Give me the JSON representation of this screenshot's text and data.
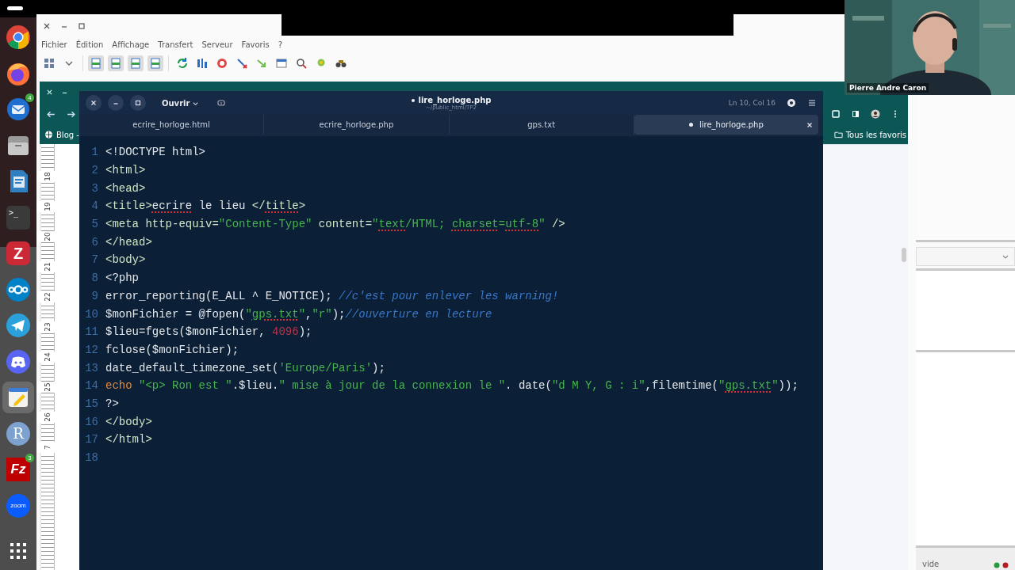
{
  "dock": {
    "items": [
      {
        "kind": "chrome",
        "selected": false
      },
      {
        "kind": "firefox",
        "selected": false
      },
      {
        "kind": "thunderbird",
        "selected": false,
        "badge": "4"
      },
      {
        "kind": "files",
        "selected": false
      },
      {
        "kind": "writer",
        "selected": false
      },
      {
        "kind": "terminal",
        "label": ">_",
        "selected": false
      },
      {
        "kind": "zotero",
        "label": "Z",
        "selected": false
      },
      {
        "kind": "nextcloud",
        "selected": false
      },
      {
        "kind": "telegram",
        "selected": false
      },
      {
        "kind": "discord",
        "selected": false
      },
      {
        "kind": "text-editor",
        "selected": true
      },
      {
        "kind": "r",
        "label": "R",
        "selected": false
      },
      {
        "kind": "filezilla",
        "label": "Fz",
        "selected": false,
        "badge": "3"
      },
      {
        "kind": "zoom",
        "label": "zoom",
        "selected": false
      },
      {
        "kind": "app-grid",
        "selected": false
      }
    ]
  },
  "ftp_window": {
    "menu": [
      "Fichier",
      "Édition",
      "Affichage",
      "Transfert",
      "Serveur",
      "Favoris",
      "?"
    ],
    "status": "vide"
  },
  "browser": {
    "bookmarks": [
      "Blog -",
      "Tous les favoris"
    ],
    "ruler": [
      "18",
      "19",
      "20",
      "21",
      "22",
      "23",
      "24",
      "25",
      "26",
      "7"
    ]
  },
  "editor": {
    "open_button": "Ouvrir",
    "title": "lire_horloge.php",
    "modified": true,
    "path": "~/public_html/TP2",
    "position": "Ln 10, Col 16",
    "tabs": [
      {
        "label": "ecrire_horloge.html",
        "selected": false,
        "modified": false
      },
      {
        "label": "ecrire_horloge.php",
        "selected": false,
        "modified": false
      },
      {
        "label": "gps.txt",
        "selected": false,
        "modified": false
      },
      {
        "label": "lire_horloge.php",
        "selected": true,
        "modified": true
      }
    ],
    "lines": [
      {
        "number": "1",
        "tokens": [
          {
            "text": "<!DOCTYPE html>",
            "kind": "plain",
            "misspelled": false
          }
        ]
      },
      {
        "number": "2",
        "tokens": [
          {
            "text": "<html>",
            "kind": "tag",
            "misspelled": false
          }
        ]
      },
      {
        "number": "3",
        "tokens": [
          {
            "text": "<head>",
            "kind": "tag",
            "misspelled": false
          }
        ]
      },
      {
        "number": "4",
        "tokens": [
          {
            "text": "<title>",
            "kind": "tag",
            "misspelled": false
          },
          {
            "text": "ecrire",
            "kind": "plain",
            "misspelled": true
          },
          {
            "text": " le lieu ",
            "kind": "plain",
            "misspelled": false
          },
          {
            "text": "</",
            "kind": "tag",
            "misspelled": false
          },
          {
            "text": "title",
            "kind": "tag",
            "misspelled": true
          },
          {
            "text": ">",
            "kind": "tag",
            "misspelled": false
          }
        ]
      },
      {
        "number": "5",
        "tokens": [
          {
            "text": "<meta http-equiv=",
            "kind": "tag",
            "misspelled": false
          },
          {
            "text": "\"Content-Type\"",
            "kind": "string",
            "misspelled": false
          },
          {
            "text": " content=",
            "kind": "tag",
            "misspelled": false
          },
          {
            "text": "\"",
            "kind": "string",
            "misspelled": false
          },
          {
            "text": "text",
            "kind": "string",
            "misspelled": true
          },
          {
            "text": "/HTML; ",
            "kind": "string",
            "misspelled": false
          },
          {
            "text": "charset",
            "kind": "string",
            "misspelled": true
          },
          {
            "text": "=",
            "kind": "string",
            "misspelled": false
          },
          {
            "text": "utf-8",
            "kind": "string",
            "misspelled": true
          },
          {
            "text": "\"",
            "kind": "string",
            "misspelled": false
          },
          {
            "text": " />",
            "kind": "tag",
            "misspelled": false
          }
        ]
      },
      {
        "number": "6",
        "tokens": [
          {
            "text": "</head>",
            "kind": "tag",
            "misspelled": false
          }
        ]
      },
      {
        "number": "7",
        "tokens": [
          {
            "text": "<body>",
            "kind": "tag",
            "misspelled": false
          }
        ]
      },
      {
        "number": "8",
        "tokens": [
          {
            "text": "<?php",
            "kind": "plain",
            "misspelled": false
          }
        ]
      },
      {
        "number": "9",
        "tokens": [
          {
            "text": "error_reporting(E_ALL ^ E_NOTICE); ",
            "kind": "plain",
            "misspelled": false
          },
          {
            "text": "//c'est pour enlever les warning!",
            "kind": "comment",
            "misspelled": false
          }
        ]
      },
      {
        "number": "10",
        "tokens": [
          {
            "text": "$monFichier = @fopen(",
            "kind": "plain",
            "misspelled": false
          },
          {
            "text": "\"",
            "kind": "string",
            "misspelled": false
          },
          {
            "text": "gps.txt",
            "kind": "string",
            "misspelled": true
          },
          {
            "text": "\"",
            "kind": "string",
            "misspelled": false
          },
          {
            "text": ",",
            "kind": "plain",
            "misspelled": false
          },
          {
            "text": "\"r\"",
            "kind": "string",
            "misspelled": false
          },
          {
            "text": ");",
            "kind": "plain",
            "misspelled": false
          },
          {
            "text": "//ouverture en lecture",
            "kind": "comment",
            "misspelled": false
          }
        ]
      },
      {
        "number": "11",
        "tokens": [
          {
            "text": "$lieu=fgets($monFichier, ",
            "kind": "plain",
            "misspelled": false
          },
          {
            "text": "4096",
            "kind": "number",
            "misspelled": false
          },
          {
            "text": ");",
            "kind": "plain",
            "misspelled": false
          }
        ]
      },
      {
        "number": "12",
        "tokens": [
          {
            "text": "fclose($monFichier);",
            "kind": "plain",
            "misspelled": false
          }
        ]
      },
      {
        "number": "13",
        "tokens": [
          {
            "text": "date_default_timezone_set(",
            "kind": "plain",
            "misspelled": false
          },
          {
            "text": "'Europe/Paris'",
            "kind": "string",
            "misspelled": false
          },
          {
            "text": ");",
            "kind": "plain",
            "misspelled": false
          }
        ]
      },
      {
        "number": "14",
        "tokens": [
          {
            "text": "echo",
            "kind": "keyword",
            "misspelled": false
          },
          {
            "text": " \"<p> Ron est \"",
            "kind": "string",
            "misspelled": false
          },
          {
            "text": ".$lieu.",
            "kind": "plain",
            "misspelled": false
          },
          {
            "text": "\" mise à jour de la connexion le \"",
            "kind": "string",
            "misspelled": false
          },
          {
            "text": ". date(",
            "kind": "plain",
            "misspelled": false
          },
          {
            "text": "\"d M Y, G : i\"",
            "kind": "string",
            "misspelled": false
          },
          {
            "text": ",filemtime(",
            "kind": "plain",
            "misspelled": false
          },
          {
            "text": "\"",
            "kind": "string",
            "misspelled": false
          },
          {
            "text": "gps.txt",
            "kind": "string",
            "misspelled": true
          },
          {
            "text": "\"",
            "kind": "string",
            "misspelled": false
          },
          {
            "text": "));",
            "kind": "plain",
            "misspelled": false
          }
        ]
      },
      {
        "number": "15",
        "tokens": [
          {
            "text": "?>",
            "kind": "plain",
            "misspelled": false
          }
        ]
      },
      {
        "number": "16",
        "tokens": [
          {
            "text": "</body>",
            "kind": "tag",
            "misspelled": false
          }
        ]
      },
      {
        "number": "17",
        "tokens": [
          {
            "text": "</html>",
            "kind": "tag",
            "misspelled": false
          }
        ]
      },
      {
        "number": "18"
      }
    ]
  },
  "webcam": {
    "name": "Pierre Andre Caron"
  }
}
